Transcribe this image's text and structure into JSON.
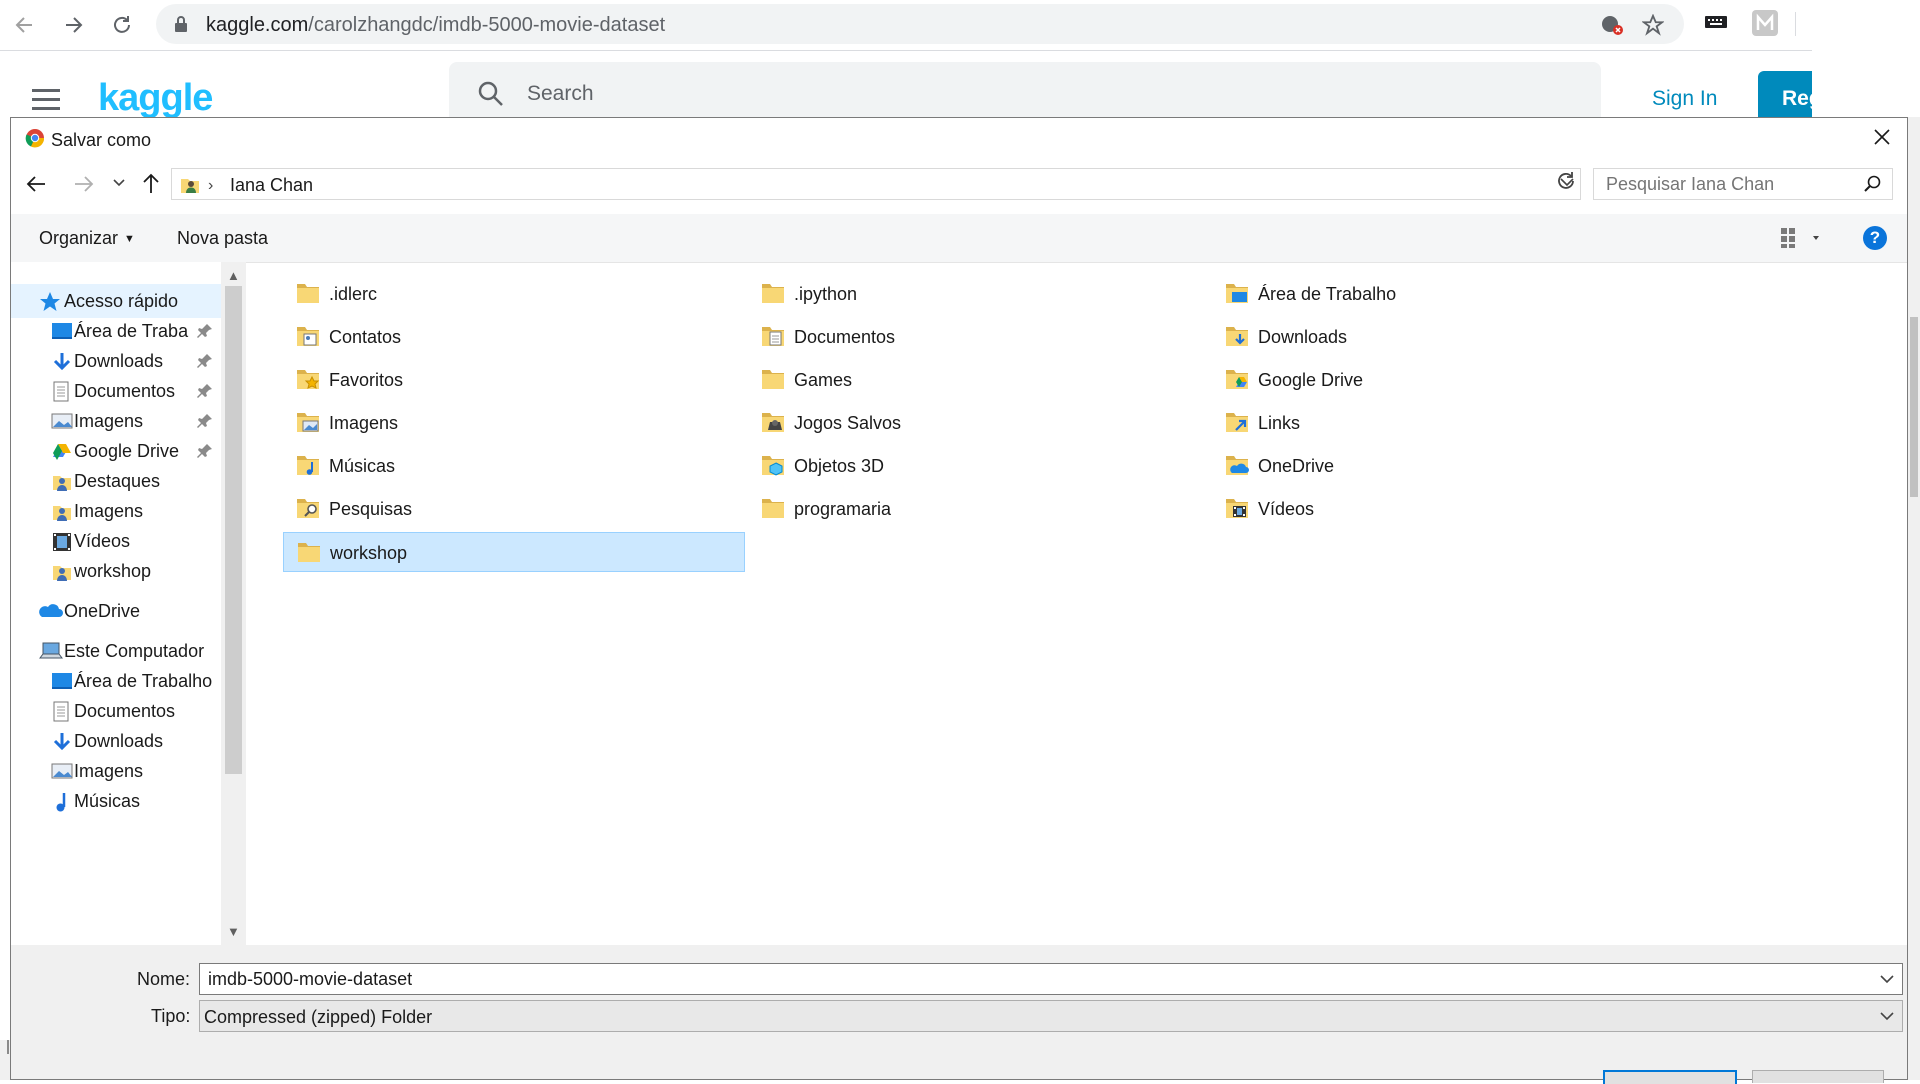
{
  "browser": {
    "url_host": "kaggle.com",
    "url_path": "/carolzhangdc/imdb-5000-movie-dataset"
  },
  "kaggle": {
    "logo": "kaggle",
    "search_placeholder": "Search",
    "sign_in": "Sign In",
    "register": "Reg"
  },
  "dialog": {
    "title": "Salvar como",
    "breadcrumb": "Iana Chan",
    "search_placeholder": "Pesquisar Iana Chan",
    "toolbar": {
      "organize": "Organizar",
      "new_folder": "Nova pasta"
    },
    "nav": [
      {
        "label": "Acesso rápido",
        "icon": "star-icon",
        "indent": 0,
        "selected": true,
        "pinned": false
      },
      {
        "label": "Área de Traba",
        "icon": "desktop-icon",
        "indent": 1,
        "selected": false,
        "pinned": true
      },
      {
        "label": "Downloads",
        "icon": "download-icon",
        "indent": 1,
        "selected": false,
        "pinned": true
      },
      {
        "label": "Documentos",
        "icon": "document-icon",
        "indent": 1,
        "selected": false,
        "pinned": true
      },
      {
        "label": "Imagens",
        "icon": "image-icon",
        "indent": 1,
        "selected": false,
        "pinned": true
      },
      {
        "label": "Google Drive",
        "icon": "google-drive-icon",
        "indent": 1,
        "selected": false,
        "pinned": true
      },
      {
        "label": "Destaques",
        "icon": "user-folder-icon",
        "indent": 1,
        "selected": false,
        "pinned": false
      },
      {
        "label": "Imagens",
        "icon": "user-folder-icon",
        "indent": 1,
        "selected": false,
        "pinned": false
      },
      {
        "label": "Vídeos",
        "icon": "video-icon",
        "indent": 1,
        "selected": false,
        "pinned": false
      },
      {
        "label": "workshop",
        "icon": "user-folder-icon",
        "indent": 1,
        "selected": false,
        "pinned": false
      },
      {
        "label": "OneDrive",
        "icon": "onedrive-icon",
        "indent": 0,
        "selected": false,
        "pinned": false
      },
      {
        "label": "Este Computador",
        "icon": "computer-icon",
        "indent": 0,
        "selected": false,
        "pinned": false
      },
      {
        "label": "Área de Trabalho",
        "icon": "desktop-icon",
        "indent": 1,
        "selected": false,
        "pinned": false
      },
      {
        "label": "Documentos",
        "icon": "document-icon",
        "indent": 1,
        "selected": false,
        "pinned": false
      },
      {
        "label": "Downloads",
        "icon": "download-icon",
        "indent": 1,
        "selected": false,
        "pinned": false
      },
      {
        "label": "Imagens",
        "icon": "image-icon",
        "indent": 1,
        "selected": false,
        "pinned": false
      },
      {
        "label": "Músicas",
        "icon": "music-icon",
        "indent": 1,
        "selected": false,
        "pinned": false
      }
    ],
    "files": [
      {
        "label": ".idlerc",
        "icon": "folder-icon",
        "selected": false
      },
      {
        "label": ".ipython",
        "icon": "folder-icon",
        "selected": false
      },
      {
        "label": "Área de Trabalho",
        "icon": "desktop-folder-icon",
        "selected": false
      },
      {
        "label": "Contatos",
        "icon": "contacts-folder-icon",
        "selected": false
      },
      {
        "label": "Documentos",
        "icon": "documents-folder-icon",
        "selected": false
      },
      {
        "label": "Downloads",
        "icon": "downloads-folder-icon",
        "selected": false
      },
      {
        "label": "Favoritos",
        "icon": "favorites-folder-icon",
        "selected": false
      },
      {
        "label": "Games",
        "icon": "folder-icon",
        "selected": false
      },
      {
        "label": "Google Drive",
        "icon": "google-drive-folder-icon",
        "selected": false
      },
      {
        "label": "Imagens",
        "icon": "images-folder-icon",
        "selected": false
      },
      {
        "label": "Jogos Salvos",
        "icon": "saved-games-folder-icon",
        "selected": false
      },
      {
        "label": "Links",
        "icon": "links-folder-icon",
        "selected": false
      },
      {
        "label": "Músicas",
        "icon": "music-folder-icon",
        "selected": false
      },
      {
        "label": "Objetos 3D",
        "icon": "3d-objects-folder-icon",
        "selected": false
      },
      {
        "label": "OneDrive",
        "icon": "onedrive-folder-icon",
        "selected": false
      },
      {
        "label": "Pesquisas",
        "icon": "searches-folder-icon",
        "selected": false
      },
      {
        "label": "programaria",
        "icon": "folder-icon",
        "selected": false
      },
      {
        "label": "Vídeos",
        "icon": "videos-folder-icon",
        "selected": false
      },
      {
        "label": "workshop",
        "icon": "folder-icon",
        "selected": true
      }
    ],
    "filename_label": "Nome:",
    "filename_value": "imdb-5000-movie-dataset",
    "type_label": "Tipo:",
    "type_value": "Compressed (zipped) Folder"
  },
  "colors": {
    "accent": "#0078d7",
    "folder": "#f8d775",
    "kaggle_blue": "#20beff",
    "selection": "#cce8ff"
  }
}
